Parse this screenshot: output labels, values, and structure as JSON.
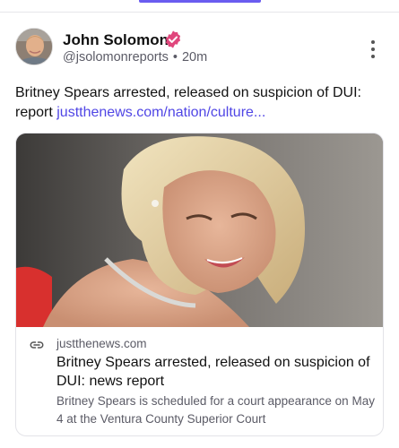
{
  "post": {
    "author_name": "John Solomon",
    "author_handle": "@jsolomonreports",
    "separator": "•",
    "time_ago": "20m",
    "text": "Britney Spears arrested, released on suspicion of DUI: report ",
    "text_link": "justthenews.com/nation/culture..."
  },
  "link_card": {
    "domain": "justthenews.com",
    "title": "Britney Spears arrested, released on suspicion of DUI: news report",
    "description": "Britney Spears is scheduled for a court appearance on May 4 at the Ventura County Superior Court"
  },
  "icons": {
    "verified": "verified-badge-icon",
    "more": "more-vertical-icon",
    "link": "link-icon"
  },
  "colors": {
    "accent": "#6a5cf0",
    "link": "#5046e5",
    "verified_badge": "#e0467c",
    "muted_text": "#5b5b66"
  }
}
